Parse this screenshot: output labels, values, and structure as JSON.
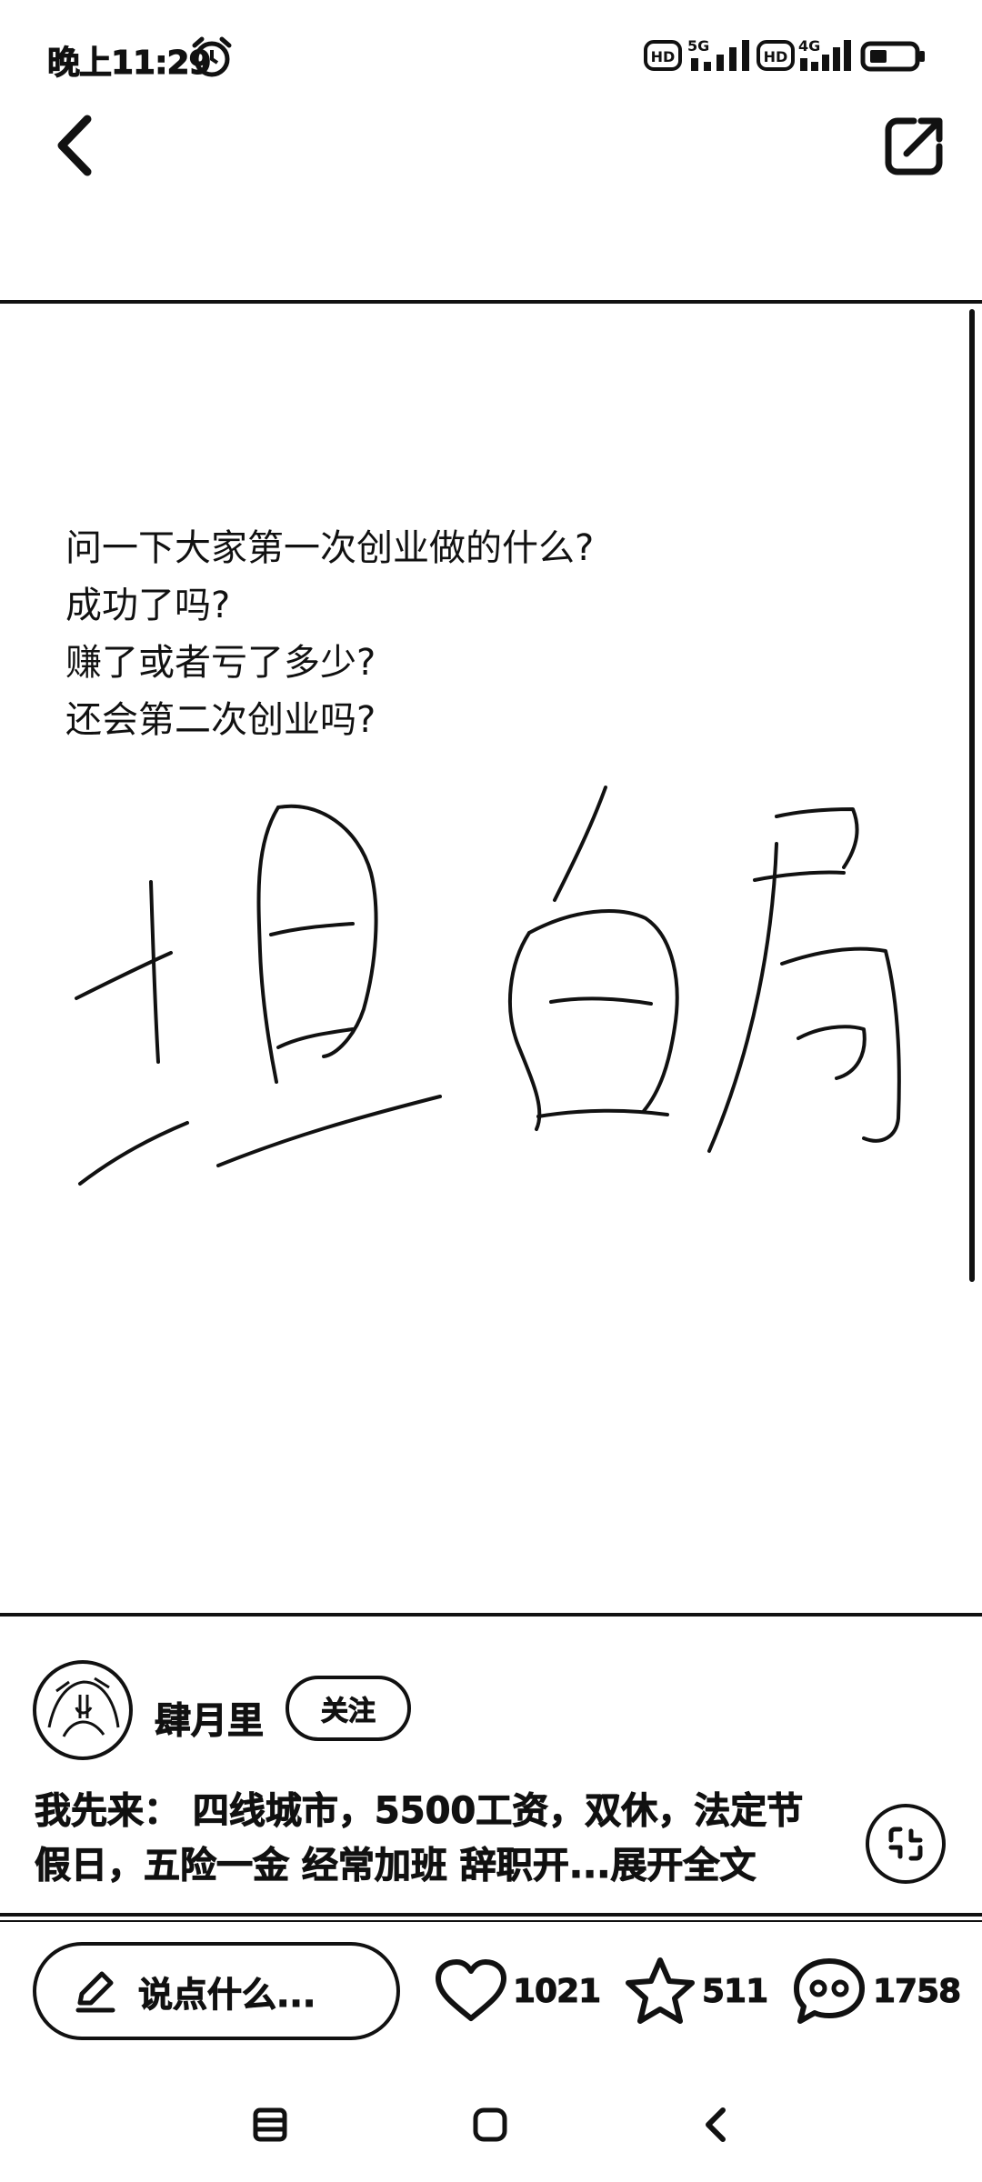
{
  "status_bar": {
    "time": "晚上11:29",
    "network_1": "5G",
    "network_2": "4G",
    "hd_badge": "HD"
  },
  "header": {
    "back_icon": "chevron-left-icon",
    "share_icon": "share-icon"
  },
  "post": {
    "lines": [
      "问一下大家第一次创业做的什么?",
      "成功了吗?",
      "赚了或者亏了多少?",
      "还会第二次创业吗?"
    ],
    "handwritten_text": "坦白局"
  },
  "author": {
    "name": "肆月里",
    "follow_label": "关注"
  },
  "excerpt": {
    "text": "我先来：  四线城市，5500工资，双休，法定节假日，五险一金 经常加班 辞职开...",
    "expand_label": "展开全文"
  },
  "actions": {
    "comment_placeholder": "说点什么...",
    "likes": "1021",
    "favorites": "511",
    "comments": "1758"
  }
}
